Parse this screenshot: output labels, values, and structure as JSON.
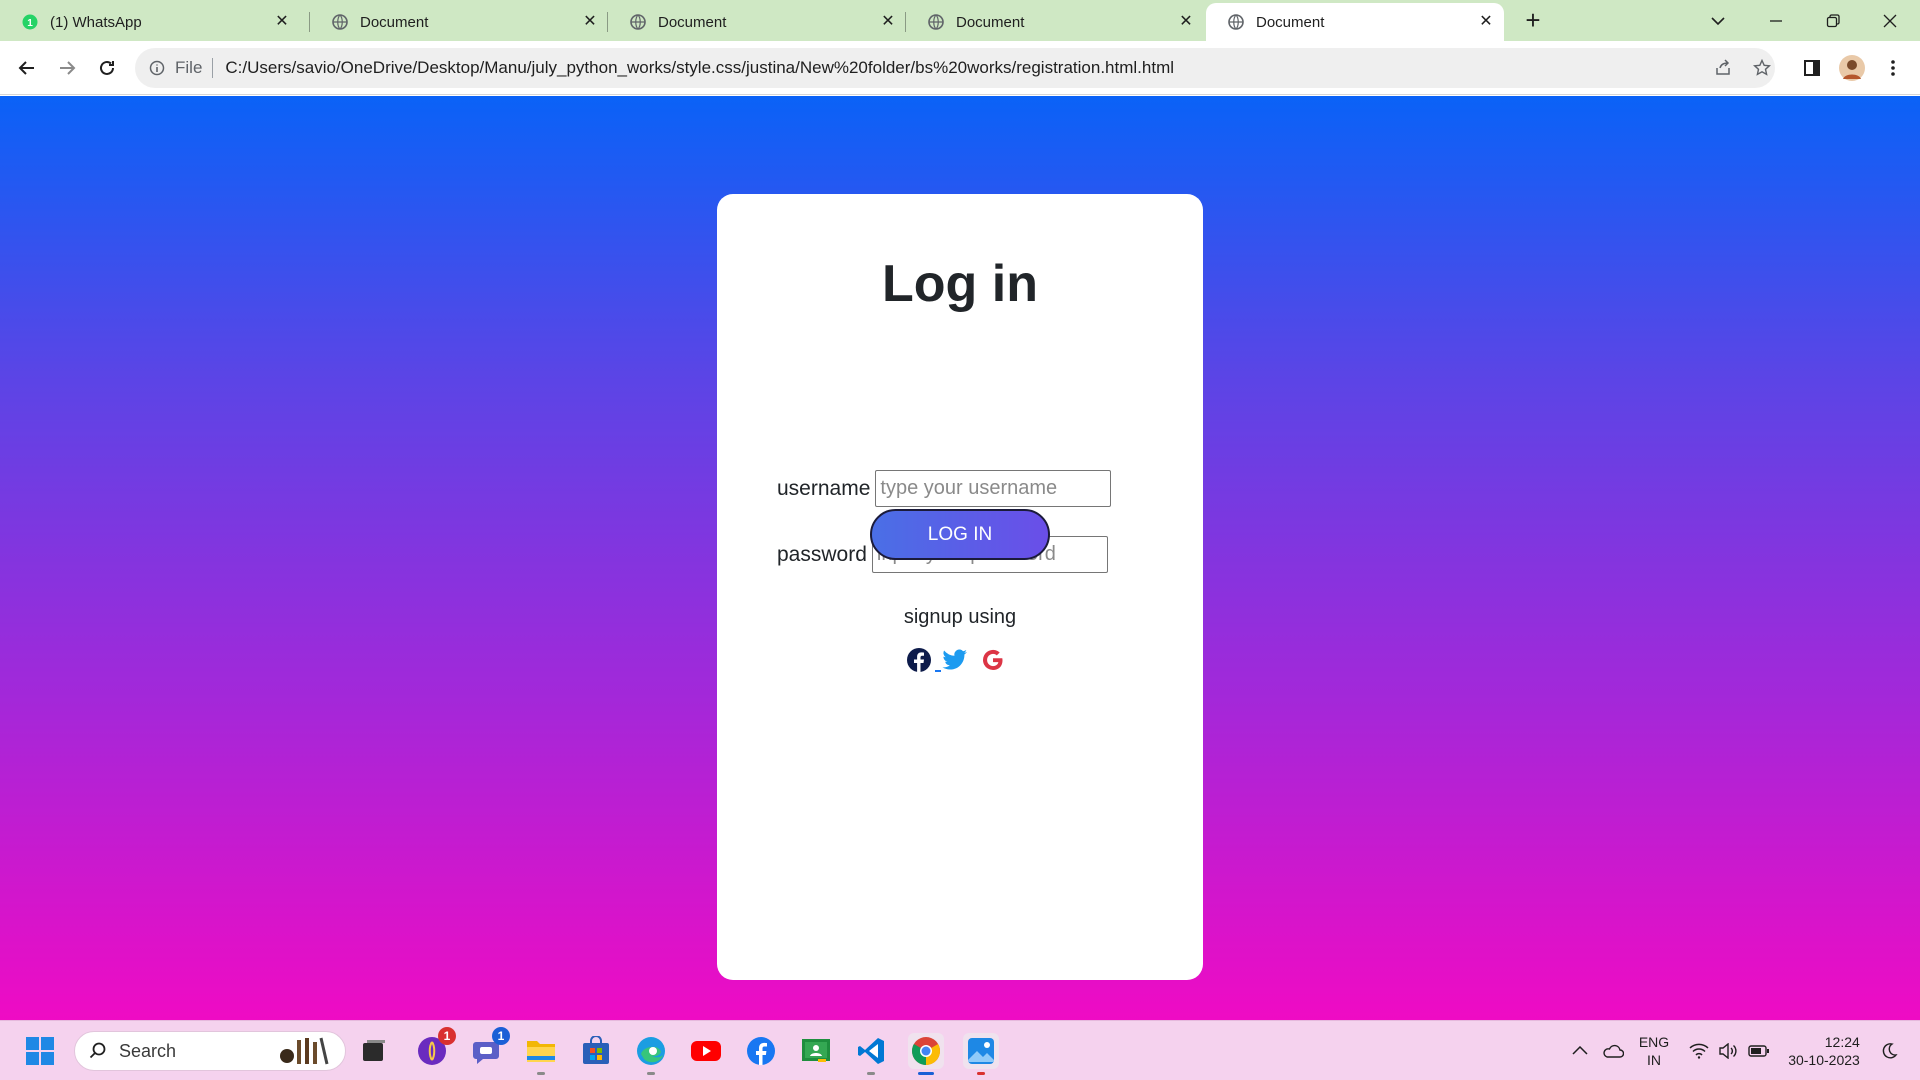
{
  "browser": {
    "tabs": [
      {
        "title": "(1) WhatsApp",
        "icon": "whatsapp-icon",
        "active": false
      },
      {
        "title": "Document",
        "icon": "globe-icon",
        "active": false
      },
      {
        "title": "Document",
        "icon": "globe-icon",
        "active": false
      },
      {
        "title": "Document",
        "icon": "globe-icon",
        "active": false
      },
      {
        "title": "Document",
        "icon": "globe-icon",
        "active": true
      }
    ],
    "address": {
      "scheme_label": "File",
      "url": "C:/Users/savio/OneDrive/Desktop/Manu/july_python_works/style.css/justina/New%20folder/bs%20works/registration.html.html"
    }
  },
  "page": {
    "title": "Log in",
    "username_label": "username",
    "username_placeholder": "type your username",
    "password_label": "password",
    "password_placeholder": "input your password",
    "login_button": "LOG IN",
    "signup_text": "signup using",
    "socials": [
      "facebook-icon",
      "twitter-icon",
      "google-icon"
    ]
  },
  "taskbar": {
    "search_label": "Search",
    "badges": {
      "app1": "1",
      "app2": "1"
    },
    "language": {
      "line1": "ENG",
      "line2": "IN"
    },
    "clock": {
      "time": "12:24",
      "date": "30-10-2023"
    }
  },
  "colors": {
    "gradient_top": "#0a62f7",
    "gradient_bottom": "#ef0bc4",
    "tabstrip": "#cfe8c4",
    "taskbar": "#f5d2ee"
  }
}
